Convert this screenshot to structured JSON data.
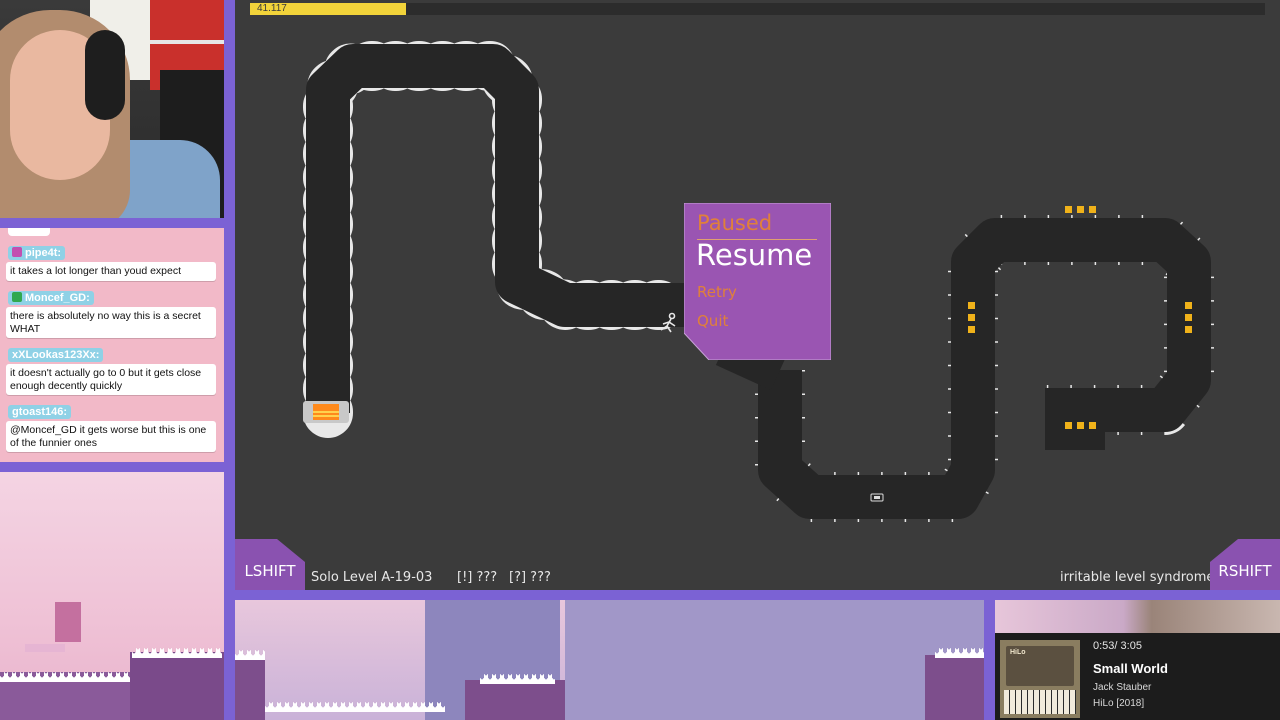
{
  "game": {
    "timer": "41.117",
    "timer_progress": 0.154,
    "pause_menu": {
      "title": "Paused",
      "resume": "Resume",
      "retry": "Retry",
      "quit": "Quit"
    },
    "lshift": "LSHIFT",
    "rshift": "RSHIFT",
    "level_name": "Solo Level A-19-03",
    "info_a": "[!] ???",
    "info_b": "[?] ???",
    "level_title": "irritable level syndrome"
  },
  "chat": {
    "messages": [
      {
        "user": "pipe4t:",
        "badge_color": "#c24fb0",
        "text": "it takes a lot longer than youd expect"
      },
      {
        "user": "Moncef_GD:",
        "badge_color": "#2fa84f",
        "text": "there is absolutely no way this is a secret WHAT"
      },
      {
        "user": "xXLookas123Xx:",
        "badge_color": "",
        "text": "it doesn't actually go to 0 but it gets close enough decently quickly"
      },
      {
        "user": "gtoast146:",
        "badge_color": "",
        "text": "@Moncef_GD it gets worse but this is one of the funnier ones"
      }
    ]
  },
  "music": {
    "time": "0:53/ 3:05",
    "title": "Small World",
    "artist": "Jack Stauber",
    "album": "HiLo [2018]",
    "cover_text": "HiLo"
  },
  "colors": {
    "game_bg": "#3b3b3b",
    "track": "#262626",
    "timer": "#f2d33a",
    "pause_panel": "#9a55b2",
    "pause_accent": "#e0803a",
    "frame": "#7b62d4"
  }
}
